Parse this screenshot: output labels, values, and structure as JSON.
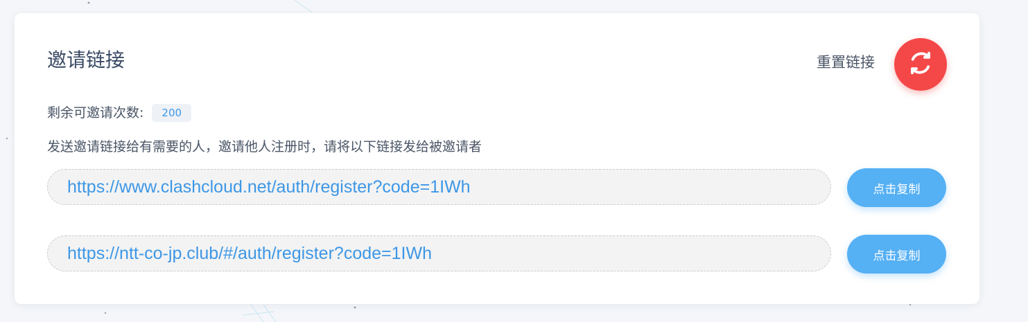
{
  "header": {
    "title": "邀请链接",
    "reset_label": "重置链接",
    "reset_icon": "refresh-icon"
  },
  "remaining": {
    "label": "剩余可邀请次数:",
    "count": "200"
  },
  "description": "发送邀请链接给有需要的人，邀请他人注册时，请将以下链接发给被邀请者",
  "links": [
    {
      "url": "https://www.clashcloud.net/auth/register?code=1IWh",
      "copy_label": "点击复制"
    },
    {
      "url": "https://ntt-co-jp.club/#/auth/register?code=1IWh",
      "copy_label": "点击复制"
    }
  ],
  "colors": {
    "accent": "#55b0f4",
    "link_text": "#3d97e6",
    "reset": "#f44848"
  }
}
